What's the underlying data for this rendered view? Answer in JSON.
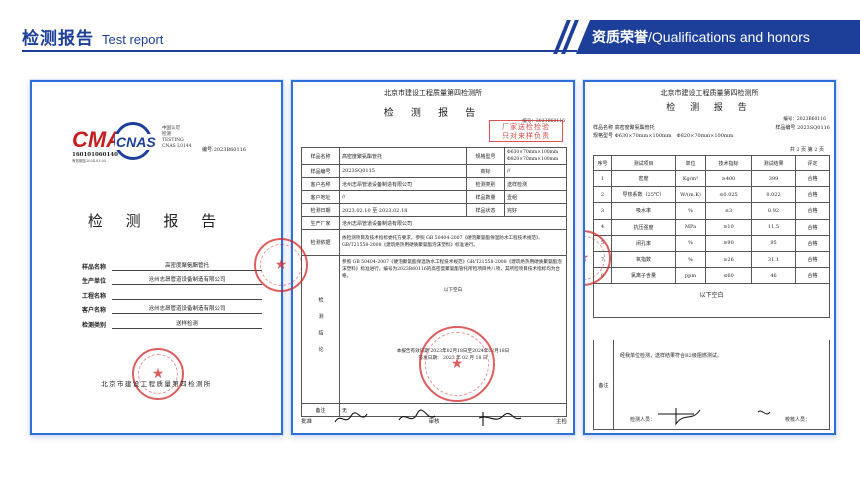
{
  "header": {
    "title_cn": "检测报告",
    "title_en": "Test report",
    "banner_cn": "资质荣誉",
    "banner_en": "/Qualifications and honors",
    "accent": "#1d3f9a",
    "frame_color": "#2f6fd8",
    "seal_color": "#d22828"
  },
  "doc1": {
    "cma_logo": "CMA",
    "cma_no": "160101060140",
    "cma_sub": "有效期至2024.03.05",
    "cnas_logo": "CNAS",
    "cnas_lines": [
      "中国认可",
      "检测",
      "TESTING",
      "CNAS L0144"
    ],
    "report_no_label": "编号:",
    "report_no": "2023B60116",
    "title": "检 测 报 告",
    "rows": [
      {
        "label": "样品名称",
        "value": "高密度聚氨酯管托"
      },
      {
        "label": "生产单位",
        "value": "沧州志昂管道设备制造有限公司"
      },
      {
        "label": "工程名称",
        "value": ""
      },
      {
        "label": "客户名称",
        "value": "沧州志昂管道设备制造有限公司"
      },
      {
        "label": "检测类别",
        "value": "送样检测"
      }
    ],
    "footer": "北京市建设工程质量第四检测所"
  },
  "doc2": {
    "org": "北京市建设工程质量第四检测所",
    "title": "检 测 报 告",
    "report_no": "编号：2023B60116",
    "stamp": [
      "厂家送检检验",
      "只对来样负责"
    ],
    "rows": {
      "sample_name_label": "样品名称",
      "sample_name": "高密度聚氨酯管托",
      "spec_label": "规格型号",
      "spec_1": "Φ630×70mm×100mm",
      "spec_2": "Φ820×70mm×100mm",
      "sample_no_label": "样品编号",
      "sample_no": "2023SQ0115",
      "brand_label": "商标",
      "brand": "//",
      "client_label": "客户名称",
      "client": "沧州志昂管道设备制造有限公司",
      "test_type_label": "检测类别",
      "test_type": "送样检测",
      "client_addr_label": "客户地址",
      "client_addr": "//",
      "qty_label": "样品数量",
      "qty": "壹组",
      "date_label": "检测日期",
      "date": "2023.02.10 至 2023.02.18",
      "status_label": "样品状态",
      "status": "完好",
      "maker_label": "生产厂家",
      "maker": "沧州志昂管道设备制造有限公司",
      "basis_label": "检测依据",
      "basis": "依检测项目及技术指标委托方要求。参照 GB 50404-2007《硬泡聚氨酯保温防水工程技术规范》、GB/T21558-2008《建筑绝热用硬质聚氨酯泡沫塑料》标准进行。",
      "conclusion_label": "检 测 结 论",
      "conclusion": "参照 GB 50404-2007《硬泡聚氨酯保温防水工程技术规范》GB/T21558-2008《建筑绝热用硬质聚氨酯泡沫塑料》标准进行，编号为2023B60116的高密度聚氨酯管托所检项目共八项，其所检项目技术指标均为合格。",
      "blank": "以下空白",
      "issue_date": "本报告有效日期 2023年02月18日至2024年02月18日",
      "sign_date": "签发日期： 2023 年 02 月 18 日",
      "note_label": "备注",
      "note": "无"
    },
    "sign": {
      "approve": "批准",
      "review": "审核",
      "main": "主检"
    }
  },
  "doc3": {
    "org": "北京市建设工程质量第四检测所",
    "title": "检 测 报 告",
    "report_no": "编号：2023B60116",
    "sample_name_label": "样品名称",
    "sample_name": "高密度聚氨酯管托",
    "sample_no_label": "样品编号",
    "sample_no": "2023SQ0116",
    "spec_label": "规格型号",
    "spec": "Φ630×70mm×100mm　Φ820×70mm×100mm",
    "page": "共 2 页 第 2 页",
    "columns": [
      "序号",
      "测试项目",
      "单位",
      "技术指标",
      "测试结果",
      "评定"
    ],
    "table": [
      [
        "1",
        "密度",
        "Kg/m³",
        "≥400",
        "399",
        "合格"
      ],
      [
        "2",
        "导热系数（25℃）",
        "W/(m.K)",
        "≤0.025",
        "0.022",
        "合格"
      ],
      [
        "3",
        "吸水率",
        "%",
        "≤3",
        "0.92",
        "合格"
      ],
      [
        "4",
        "抗压强度",
        "MPa",
        "≥10",
        "11.5",
        "合格"
      ],
      [
        "5",
        "闭孔率",
        "%",
        "≥90",
        "95",
        "合格"
      ],
      [
        "7",
        "氧指数",
        "%",
        "≥26",
        "31.1",
        "合格"
      ],
      [
        "8",
        "氯离子含量",
        "ppm",
        "≤60",
        "46",
        "合格"
      ]
    ],
    "blank": "以下空白",
    "note_label": "备注",
    "note": "经我单位检测，送样结果符合B2级阻燃测试。",
    "tester": "检测人员：",
    "checker": "校核人员："
  }
}
